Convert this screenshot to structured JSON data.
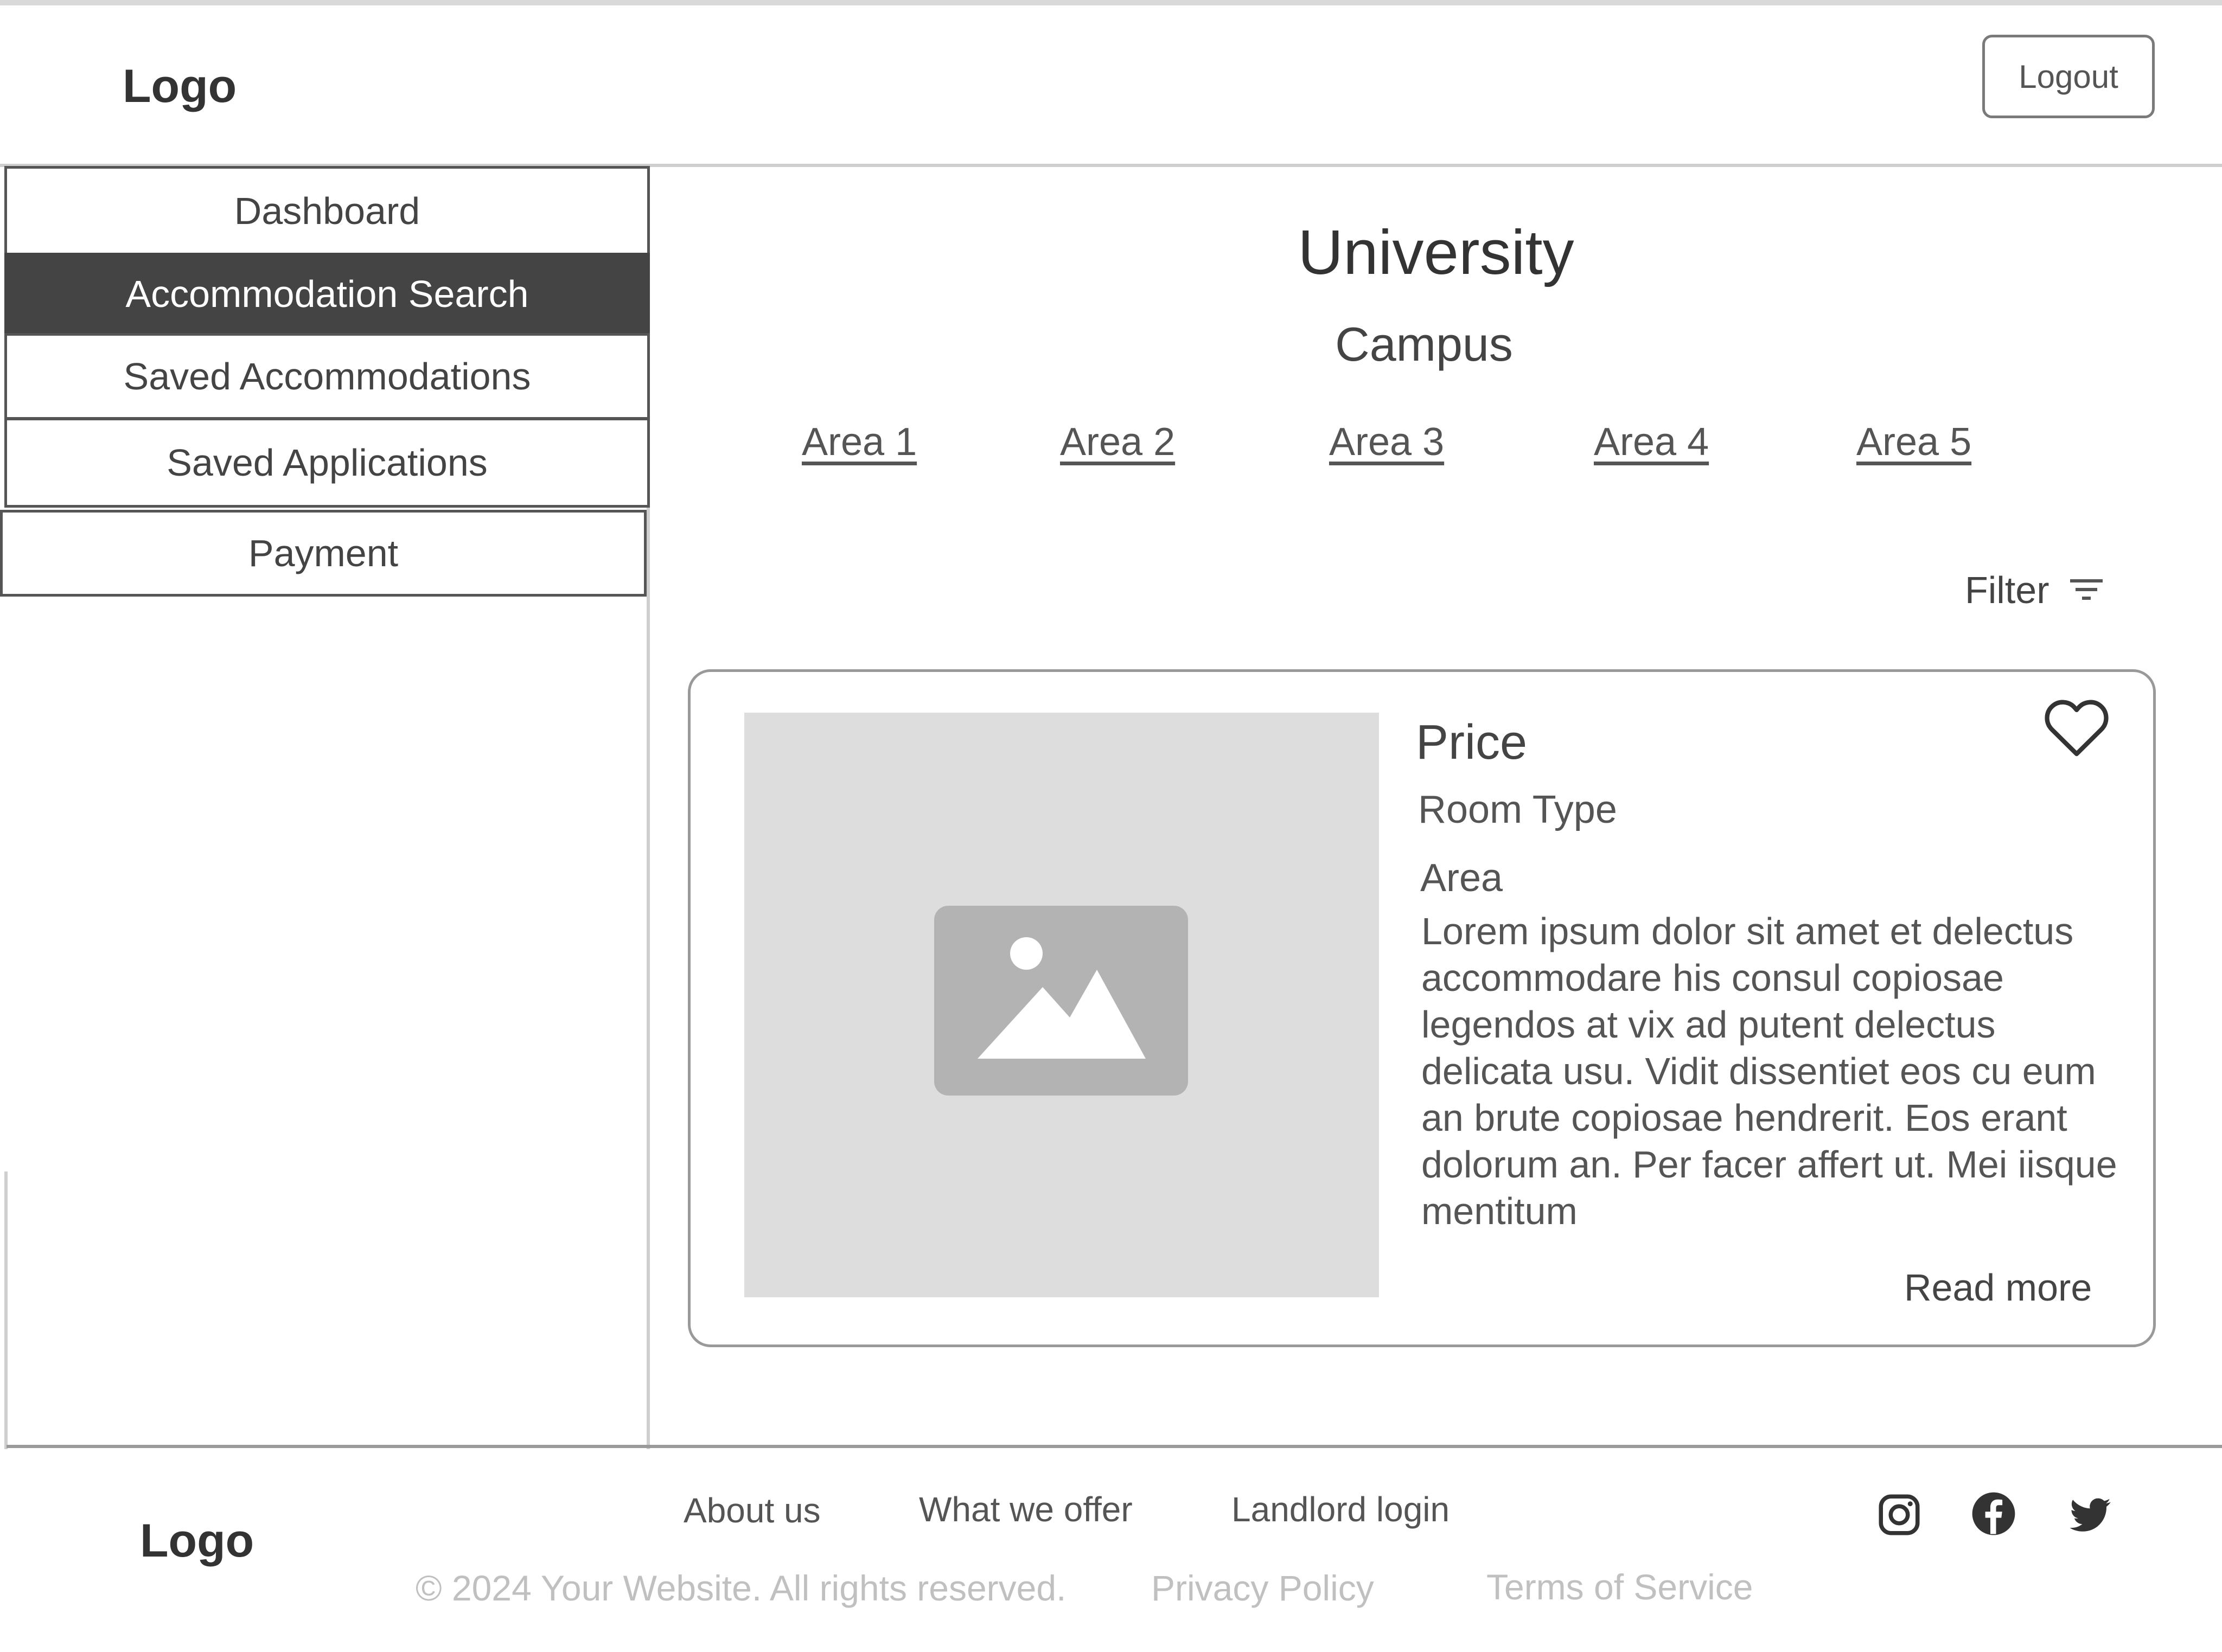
{
  "header": {
    "logo": "Logo",
    "logout_label": "Logout"
  },
  "sidebar": {
    "items": [
      {
        "label": "Dashboard",
        "active": false
      },
      {
        "label": "Accommodation Search",
        "active": true
      },
      {
        "label": "Saved Accommodations",
        "active": false
      },
      {
        "label": "Saved Applications",
        "active": false
      },
      {
        "label": "Payment",
        "active": false
      }
    ]
  },
  "main": {
    "title": "University",
    "subtitle": "Campus",
    "areas": [
      "Area 1",
      "Area 2",
      "Area 3",
      "Area 4",
      "Area 5"
    ],
    "filter_label": "Filter",
    "card": {
      "price": "Price",
      "room_type": "Room Type",
      "area": "Area",
      "description": "Lorem ipsum dolor sit amet et delectus accommodare his consul copiosae legendos at vix ad putent delectus delicata usu. Vidit dissentiet eos cu eum an brute copiosae hendrerit. Eos erant dolorum an. Per facer affert ut. Mei iisque mentitum",
      "read_more": "Read more"
    }
  },
  "footer": {
    "logo": "Logo",
    "links": [
      "About us",
      "What we offer",
      "Landlord login"
    ],
    "copyright": "© 2024 Your Website. All rights reserved.",
    "privacy": "Privacy Policy",
    "terms": "Terms of Service",
    "social_icons": [
      "instagram-icon",
      "facebook-icon",
      "twitter-icon"
    ]
  },
  "colors": {
    "active_nav_bg": "#444444",
    "image_placeholder": "#dddddd",
    "muted_text": "#c0c0c0"
  }
}
